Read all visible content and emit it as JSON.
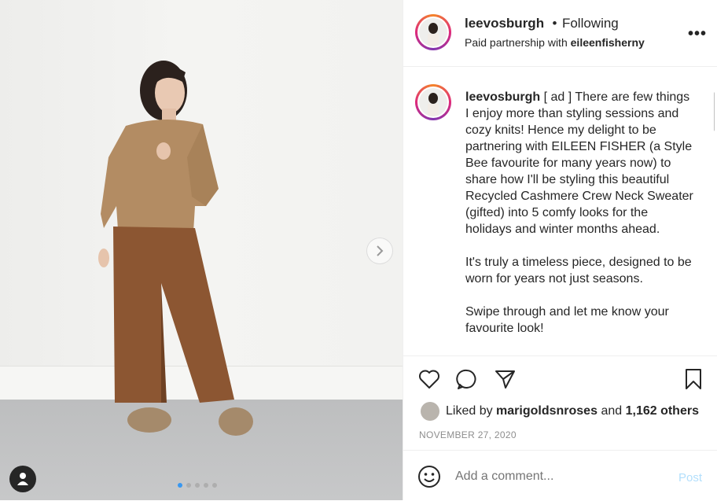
{
  "header": {
    "username": "leevosburgh",
    "separator": "•",
    "follow_status": "Following",
    "partnership_prefix": "Paid partnership with",
    "partner": "eileenfisherny",
    "more_icon": "more-options-icon",
    "more_label": "•••"
  },
  "caption": {
    "username": "leevosburgh",
    "paragraphs": [
      "[ ad ] There are few things I enjoy more than styling sessions and cozy knits! Hence my delight to be partnering with EILEEN FISHER (a Style Bee favourite for many years now) to share how I'll be styling this beautiful Recycled Cashmere Crew Neck Sweater (gifted) into 5 comfy looks for the holidays and winter months ahead.",
      "It's truly a timeless piece, designed to be worn for years not just seasons.",
      "Swipe through and let me know your favourite look!"
    ]
  },
  "media": {
    "carousel_count": 5,
    "carousel_active_index": 0
  },
  "actions": {
    "icons": [
      "heart-icon",
      "comment-icon",
      "share-icon",
      "bookmark-icon"
    ],
    "liked_by_prefix": "Liked by",
    "liked_by_user": "marigoldsnroses",
    "liked_by_and": "and",
    "liked_by_count": "1,162 others",
    "date": "NOVEMBER 27, 2020"
  },
  "comment": {
    "placeholder": "Add a comment...",
    "post_label": "Post"
  },
  "colors": {
    "link_blue": "#3897f0",
    "post_disabled": "#b2dffc",
    "text": "#262626",
    "muted": "#8e8e8e"
  }
}
